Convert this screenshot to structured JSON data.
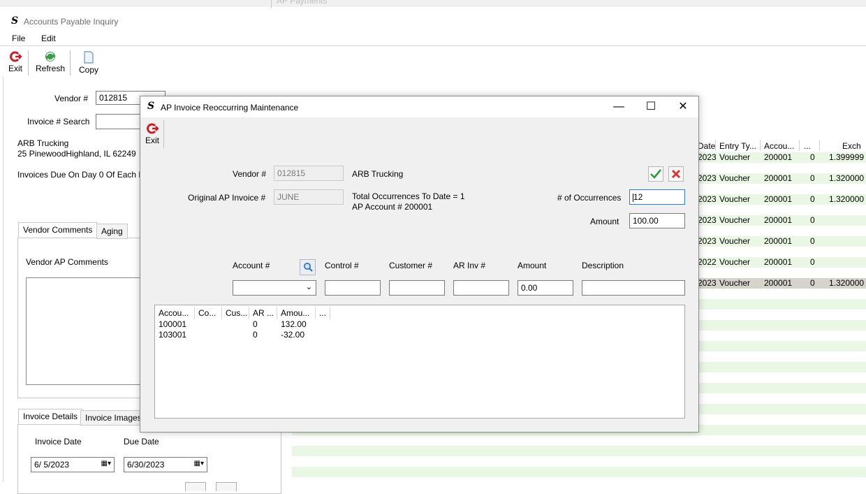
{
  "background_window": {
    "title_fragment": "AP Payments"
  },
  "main_window": {
    "title": "Accounts Payable Inquiry",
    "menu": [
      "File",
      "Edit"
    ],
    "toolbar": {
      "exit": "Exit",
      "refresh": "Refresh",
      "copy": "Copy"
    },
    "vendor_label": "Vendor #",
    "vendor_value": "012815",
    "invoice_search_label": "Invoice # Search",
    "invoice_search_value": "",
    "vendor_name": "ARB Trucking",
    "vendor_address": "25 PinewoodHighland, IL  62249",
    "due_note": "Invoices Due On Day 0 Of Each M",
    "tabs_top": [
      "Vendor Comments",
      "Aging"
    ],
    "vendor_ap_comments_label": "Vendor AP Comments",
    "tabs_bottom": [
      "Invoice Details",
      "Invoice Images"
    ],
    "invoice_date_label": "Invoice Date",
    "due_date_label": "Due Date",
    "invoice_date_value": "6/  5/2023",
    "due_date_value": "6/30/2023"
  },
  "grid": {
    "headers": {
      "date": "Date",
      "entry_type": "Entry Ty...",
      "account": "Accou...",
      "more": "...",
      "exch": "Exch"
    },
    "rows": [
      {
        "date": "2023",
        "entry_type": "Voucher",
        "account": "200001",
        "n": "0",
        "exch": "1.399999"
      },
      {
        "date": "2023",
        "entry_type": "Voucher",
        "account": "200001",
        "n": "0",
        "exch": "1.320000"
      },
      {
        "date": "2023",
        "entry_type": "Voucher",
        "account": "200001",
        "n": "0",
        "exch": "1.320000"
      },
      {
        "date": "2023",
        "entry_type": "Voucher",
        "account": "200001",
        "n": "0",
        "exch": ""
      },
      {
        "date": "2023",
        "entry_type": "Voucher",
        "account": "200001",
        "n": "0",
        "exch": ""
      },
      {
        "date": "2022",
        "entry_type": "Voucher",
        "account": "200001",
        "n": "0",
        "exch": ""
      },
      {
        "date": "2023",
        "entry_type": "Voucher",
        "account": "200001",
        "n": "0",
        "exch": "1.320000"
      }
    ]
  },
  "dialog": {
    "title": "AP Invoice Reoccurring Maintenance",
    "exit_label": "Exit",
    "vendor_label": "Vendor #",
    "vendor_value": "012815",
    "vendor_name": "ARB Trucking",
    "orig_invoice_label": "Original AP Invoice #",
    "orig_invoice_value": "JUNE",
    "total_occurrences": "Total Occurrences To Date = 1",
    "ap_account": "AP Account # 200001",
    "occurrences_label": "# of Occurrences",
    "occurrences_value": "12",
    "amount_label": "Amount",
    "amount_value": "100.00",
    "line_labels": {
      "account": "Account #",
      "control": "Control #",
      "customer": "Customer #",
      "ar_inv": "AR Inv #",
      "amount": "Amount",
      "description": "Description"
    },
    "line_amount_value": "0.00",
    "list_headers": [
      "Accou...",
      "Co...",
      "Cus...",
      "AR ...",
      "Amou...",
      "..."
    ],
    "list_rows": [
      {
        "account": "100001",
        "ar": "0",
        "amount": "132.00"
      },
      {
        "account": "103001",
        "ar": "0",
        "amount": "-32.00"
      }
    ]
  },
  "colors": {
    "exit_red": "#c0212b",
    "refresh_green": "#2f8a3d",
    "ok_green": "#2e9b3a",
    "cancel_red": "#d23a3a",
    "grid_stripe": "#eaf7e5",
    "grid_selected": "#d6d3cc"
  }
}
